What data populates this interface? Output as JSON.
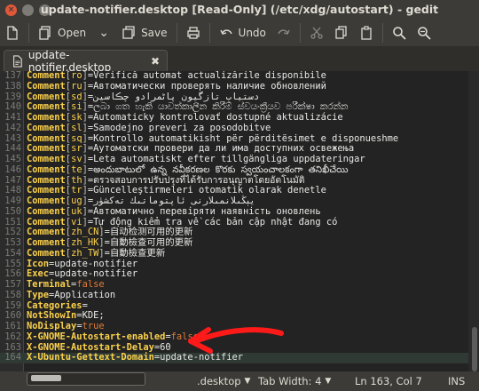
{
  "window": {
    "title": "update-notifier.desktop [Read-Only] (/etc/xdg/autostart) - gedit"
  },
  "toolbar": {
    "open_label": "Open",
    "save_label": "Save",
    "undo_label": "Undo"
  },
  "tab": {
    "label": "update-notifier.desktop"
  },
  "editor": {
    "lines": [
      {
        "n": "137",
        "key": "Comment",
        "loc": "ro",
        "val": "Verifică automat actualizările disponibile"
      },
      {
        "n": "138",
        "key": "Comment",
        "loc": "ru",
        "val": "Автоматически проверять наличие обновлений"
      },
      {
        "n": "139",
        "key": "Comment",
        "loc": "sd",
        "val": "دستیاب تازگیون پاڻمرادو چڪاسين"
      },
      {
        "n": "140",
        "key": "Comment",
        "loc": "si",
        "val": "ලබා ගත හැකි යාවත්කාලීන කිරීම් ස්වයංක්‍රීයව පරීක්ෂා කරන්න"
      },
      {
        "n": "141",
        "key": "Comment",
        "loc": "sk",
        "val": "Automaticky kontrolovať dostupné aktualizácie"
      },
      {
        "n": "142",
        "key": "Comment",
        "loc": "sl",
        "val": "Samodejno preveri za posodobitve"
      },
      {
        "n": "143",
        "key": "Comment",
        "loc": "sq",
        "val": "Kontrollo automatikisht për përditësimet e disponueshme"
      },
      {
        "n": "144",
        "key": "Comment",
        "loc": "sr",
        "val": "Аутоматски провери да ли има доступних освежења"
      },
      {
        "n": "145",
        "key": "Comment",
        "loc": "sv",
        "val": "Leta automatiskt efter tillgängliga uppdateringar"
      },
      {
        "n": "146",
        "key": "Comment",
        "loc": "te",
        "val": "అందుబాటులో ఉన్న నవీకరణల కొరకు స్వయంచాలకంగా తనిఖీచేయి"
      },
      {
        "n": "147",
        "key": "Comment",
        "loc": "th",
        "val": "ตรวจสอบการปรับปรุงที่ได้รับการอนุญาตโดยอัตโนมัติ"
      },
      {
        "n": "148",
        "key": "Comment",
        "loc": "tr",
        "val": "Güncelleştirmeleri otomatik olarak denetle"
      },
      {
        "n": "149",
        "key": "Comment",
        "loc": "ug",
        "val": "يېڭىلانمىلارنى ئاپتوماتىك تەكشۈر"
      },
      {
        "n": "150",
        "key": "Comment",
        "loc": "uk",
        "val": "Автоматично перевіряти наявність оновлень"
      },
      {
        "n": "151",
        "key": "Comment",
        "loc": "vi",
        "val": "Tự động kiểm tra về các bản cập nhật đang có"
      },
      {
        "n": "152",
        "key": "Comment",
        "loc": "zh_CN",
        "val": "自动检测可用的更新"
      },
      {
        "n": "153",
        "key": "Comment",
        "loc": "zh_HK",
        "val": "自動檢查可用的更新"
      },
      {
        "n": "154",
        "key": "Comment",
        "loc": "zh_TW",
        "val": "自動檢查更新"
      },
      {
        "n": "155",
        "key": "Icon",
        "loc": "",
        "val": "update-notifier"
      },
      {
        "n": "156",
        "key": "Exec",
        "loc": "",
        "val": "update-notifier"
      },
      {
        "n": "157",
        "key": "Terminal",
        "loc": "",
        "val": "false",
        "kw": "bool"
      },
      {
        "n": "158",
        "key": "Type",
        "loc": "",
        "val": "Application"
      },
      {
        "n": "159",
        "key": "Categories",
        "loc": "",
        "val": ""
      },
      {
        "n": "160",
        "key": "NotShowIn",
        "loc": "",
        "val": "KDE;"
      },
      {
        "n": "161",
        "key": "NoDisplay",
        "loc": "",
        "val": "true",
        "kw": "bool"
      },
      {
        "n": "162",
        "key": "X-GNOME-Autostart-enabled",
        "loc": "",
        "val": "false",
        "kw": "bool"
      },
      {
        "n": "163",
        "key": "X-GNOME-Autostart-Delay",
        "loc": "",
        "val": "60"
      },
      {
        "n": "164",
        "key": "X-Ubuntu-Gettext-Domain",
        "loc": "",
        "val": "update-notifier"
      }
    ]
  },
  "statusbar": {
    "language": ".desktop",
    "tab_width": "Tab Width: 4",
    "position": "Ln 163, Col 7",
    "mode": "INS"
  },
  "colors": {
    "key": "#fbd14b",
    "bool": "#e07b39",
    "annotation_arrow": "#ff1a1a"
  }
}
